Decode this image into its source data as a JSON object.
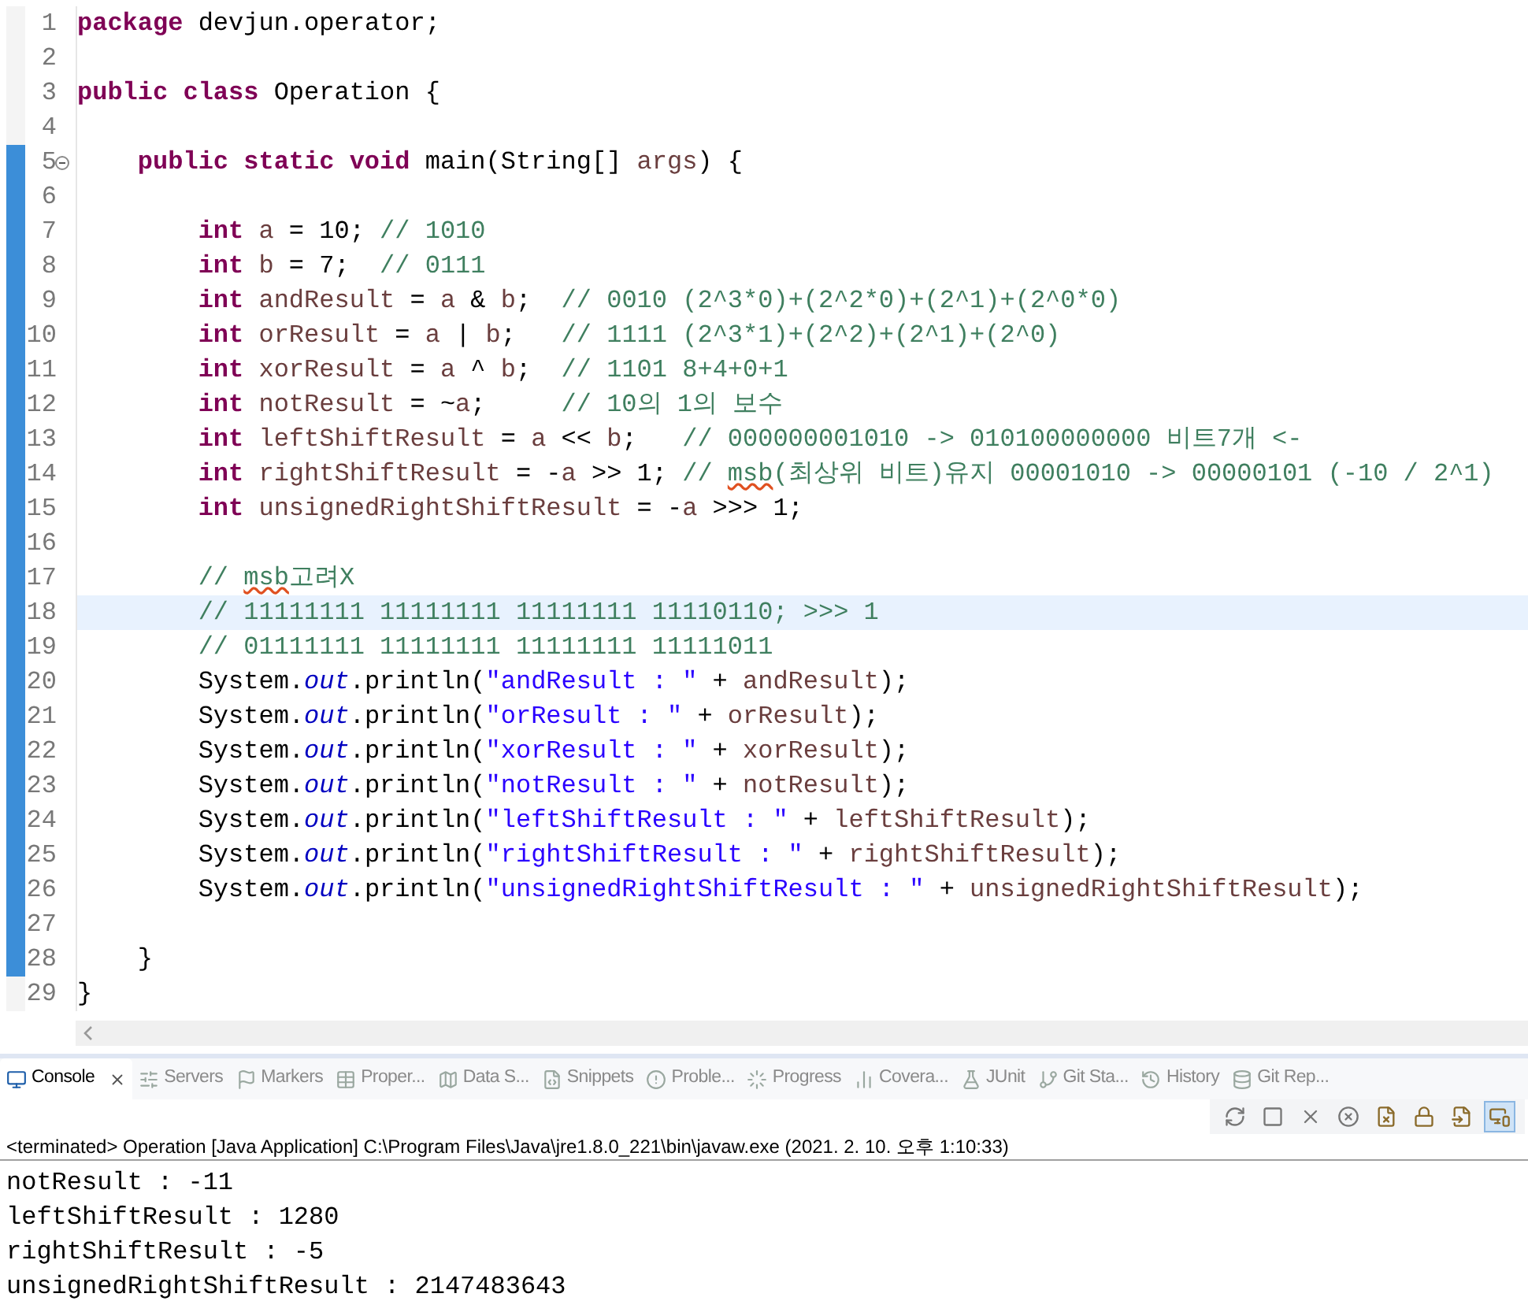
{
  "editor": {
    "lines": [
      {
        "number": "1",
        "changed": false,
        "current": false,
        "fold": false,
        "segments": [
          {
            "kind": "keyword",
            "text": "package"
          },
          {
            "kind": "plain",
            "text": " devjun.operator;"
          }
        ]
      },
      {
        "number": "2",
        "changed": false,
        "current": false,
        "fold": false
      },
      {
        "number": "3",
        "changed": false,
        "current": false,
        "fold": false,
        "segments": [
          {
            "kind": "keyword",
            "text": "public class"
          },
          {
            "kind": "plain",
            "text": " Operation {"
          }
        ]
      },
      {
        "number": "4",
        "changed": false,
        "current": false,
        "fold": false
      },
      {
        "number": "5",
        "changed": true,
        "current": false,
        "fold": true,
        "segments": [
          {
            "kind": "keyword",
            "text": "    public static void"
          },
          {
            "kind": "plain",
            "text": " main(String[] "
          },
          {
            "kind": "variable",
            "text": "args"
          },
          {
            "kind": "plain",
            "text": ") {"
          }
        ]
      },
      {
        "number": "6",
        "changed": true,
        "current": false,
        "fold": false
      },
      {
        "number": "7",
        "changed": true,
        "current": false,
        "fold": false,
        "segments": [
          {
            "kind": "keyword",
            "text": "        int"
          },
          {
            "kind": "variable",
            "text": " a"
          },
          {
            "kind": "plain",
            "text": " = 10; "
          },
          {
            "kind": "comment",
            "text": "// 1010"
          }
        ]
      },
      {
        "number": "8",
        "changed": true,
        "current": false,
        "fold": false,
        "segments": [
          {
            "kind": "keyword",
            "text": "        int"
          },
          {
            "kind": "variable",
            "text": " b"
          },
          {
            "kind": "plain",
            "text": " = 7;  "
          },
          {
            "kind": "comment",
            "text": "// 0111"
          }
        ]
      },
      {
        "number": "9",
        "changed": true,
        "current": false,
        "fold": false,
        "segments": [
          {
            "kind": "keyword",
            "text": "        int"
          },
          {
            "kind": "variable",
            "text": " andResult"
          },
          {
            "kind": "plain",
            "text": " = "
          },
          {
            "kind": "variable",
            "text": "a"
          },
          {
            "kind": "plain",
            "text": " & "
          },
          {
            "kind": "variable",
            "text": "b"
          },
          {
            "kind": "plain",
            "text": ";  "
          },
          {
            "kind": "comment",
            "text": "// 0010 (2^3*0)+(2^2*0)+(2^1)+(2^0*0)"
          }
        ]
      },
      {
        "number": "10",
        "changed": true,
        "current": false,
        "fold": false,
        "segments": [
          {
            "kind": "keyword",
            "text": "        int"
          },
          {
            "kind": "variable",
            "text": " orResult"
          },
          {
            "kind": "plain",
            "text": " = "
          },
          {
            "kind": "variable",
            "text": "a"
          },
          {
            "kind": "plain",
            "text": " | "
          },
          {
            "kind": "variable",
            "text": "b"
          },
          {
            "kind": "plain",
            "text": ";   "
          },
          {
            "kind": "comment",
            "text": "// 1111 (2^3*1)+(2^2)+(2^1)+(2^0)"
          }
        ]
      },
      {
        "number": "11",
        "changed": true,
        "current": false,
        "fold": false,
        "segments": [
          {
            "kind": "keyword",
            "text": "        int"
          },
          {
            "kind": "variable",
            "text": " xorResult"
          },
          {
            "kind": "plain",
            "text": " = "
          },
          {
            "kind": "variable",
            "text": "a"
          },
          {
            "kind": "plain",
            "text": " ^ "
          },
          {
            "kind": "variable",
            "text": "b"
          },
          {
            "kind": "plain",
            "text": ";  "
          },
          {
            "kind": "comment",
            "text": "// 1101 8+4+0+1"
          }
        ]
      },
      {
        "number": "12",
        "changed": true,
        "current": false,
        "fold": false,
        "segments": [
          {
            "kind": "keyword",
            "text": "        int"
          },
          {
            "kind": "variable",
            "text": " notResult"
          },
          {
            "kind": "plain",
            "text": " = ~"
          },
          {
            "kind": "variable",
            "text": "a"
          },
          {
            "kind": "plain",
            "text": ";     "
          },
          {
            "kind": "comment",
            "text": "// 10의 1의 보수"
          }
        ]
      },
      {
        "number": "13",
        "changed": true,
        "current": false,
        "fold": false,
        "segments": [
          {
            "kind": "keyword",
            "text": "        int"
          },
          {
            "kind": "variable",
            "text": " leftShiftResult"
          },
          {
            "kind": "plain",
            "text": " = "
          },
          {
            "kind": "variable",
            "text": "a"
          },
          {
            "kind": "plain",
            "text": " << "
          },
          {
            "kind": "variable",
            "text": "b"
          },
          {
            "kind": "plain",
            "text": ";   "
          },
          {
            "kind": "comment",
            "text": "// 000000001010 -> 010100000000 비트7개 <-"
          }
        ]
      },
      {
        "number": "14",
        "changed": true,
        "current": false,
        "fold": false,
        "segments": [
          {
            "kind": "keyword",
            "text": "        int"
          },
          {
            "kind": "variable",
            "text": " rightShiftResult"
          },
          {
            "kind": "plain",
            "text": " = -"
          },
          {
            "kind": "variable",
            "text": "a"
          },
          {
            "kind": "plain",
            "text": " >> 1; "
          },
          {
            "kind": "comment",
            "text": "// "
          },
          {
            "kind": "misspelled",
            "text": "msb"
          },
          {
            "kind": "comment",
            "text": "(최상위 비트)유지 00001010 -> 00000101 (-10 / 2^1)"
          }
        ]
      },
      {
        "number": "15",
        "changed": true,
        "current": false,
        "fold": false,
        "segments": [
          {
            "kind": "keyword",
            "text": "        int"
          },
          {
            "kind": "variable",
            "text": " unsignedRightShiftResult"
          },
          {
            "kind": "plain",
            "text": " = -"
          },
          {
            "kind": "variable",
            "text": "a"
          },
          {
            "kind": "plain",
            "text": " >>> 1;"
          }
        ]
      },
      {
        "number": "16",
        "changed": true,
        "current": false,
        "fold": false
      },
      {
        "number": "17",
        "changed": true,
        "current": false,
        "fold": false,
        "segments": [
          {
            "kind": "comment",
            "text": "        // "
          },
          {
            "kind": "misspelled",
            "text": "msb"
          },
          {
            "kind": "comment",
            "text": "고려X"
          }
        ]
      },
      {
        "number": "18",
        "changed": true,
        "current": true,
        "fold": false,
        "segments": [
          {
            "kind": "comment",
            "text": "        // 11111111 11111111 11111111 11110110; >>> 1"
          }
        ]
      },
      {
        "number": "19",
        "changed": true,
        "current": false,
        "fold": false,
        "segments": [
          {
            "kind": "comment",
            "text": "        // 01111111 11111111 11111111 11111011"
          }
        ]
      },
      {
        "number": "20",
        "changed": true,
        "current": false,
        "fold": false,
        "segments": [
          {
            "kind": "plain",
            "text": "        System."
          },
          {
            "kind": "field",
            "text": "out"
          },
          {
            "kind": "plain",
            "text": ".println("
          },
          {
            "kind": "string",
            "text": "\"andResult : \""
          },
          {
            "kind": "plain",
            "text": " + "
          },
          {
            "kind": "variable",
            "text": "andResult"
          },
          {
            "kind": "plain",
            "text": ");"
          }
        ]
      },
      {
        "number": "21",
        "changed": true,
        "current": false,
        "fold": false,
        "segments": [
          {
            "kind": "plain",
            "text": "        System."
          },
          {
            "kind": "field",
            "text": "out"
          },
          {
            "kind": "plain",
            "text": ".println("
          },
          {
            "kind": "string",
            "text": "\"orResult : \""
          },
          {
            "kind": "plain",
            "text": " + "
          },
          {
            "kind": "variable",
            "text": "orResult"
          },
          {
            "kind": "plain",
            "text": ");"
          }
        ]
      },
      {
        "number": "22",
        "changed": true,
        "current": false,
        "fold": false,
        "segments": [
          {
            "kind": "plain",
            "text": "        System."
          },
          {
            "kind": "field",
            "text": "out"
          },
          {
            "kind": "plain",
            "text": ".println("
          },
          {
            "kind": "string",
            "text": "\"xorResult : \""
          },
          {
            "kind": "plain",
            "text": " + "
          },
          {
            "kind": "variable",
            "text": "xorResult"
          },
          {
            "kind": "plain",
            "text": ");"
          }
        ]
      },
      {
        "number": "23",
        "changed": true,
        "current": false,
        "fold": false,
        "segments": [
          {
            "kind": "plain",
            "text": "        System."
          },
          {
            "kind": "field",
            "text": "out"
          },
          {
            "kind": "plain",
            "text": ".println("
          },
          {
            "kind": "string",
            "text": "\"notResult : \""
          },
          {
            "kind": "plain",
            "text": " + "
          },
          {
            "kind": "variable",
            "text": "notResult"
          },
          {
            "kind": "plain",
            "text": ");"
          }
        ]
      },
      {
        "number": "24",
        "changed": true,
        "current": false,
        "fold": false,
        "segments": [
          {
            "kind": "plain",
            "text": "        System."
          },
          {
            "kind": "field",
            "text": "out"
          },
          {
            "kind": "plain",
            "text": ".println("
          },
          {
            "kind": "string",
            "text": "\"leftShiftResult : \""
          },
          {
            "kind": "plain",
            "text": " + "
          },
          {
            "kind": "variable",
            "text": "leftShiftResult"
          },
          {
            "kind": "plain",
            "text": ");"
          }
        ]
      },
      {
        "number": "25",
        "changed": true,
        "current": false,
        "fold": false,
        "segments": [
          {
            "kind": "plain",
            "text": "        System."
          },
          {
            "kind": "field",
            "text": "out"
          },
          {
            "kind": "plain",
            "text": ".println("
          },
          {
            "kind": "string",
            "text": "\"rightShiftResult : \""
          },
          {
            "kind": "plain",
            "text": " + "
          },
          {
            "kind": "variable",
            "text": "rightShiftResult"
          },
          {
            "kind": "plain",
            "text": ");"
          }
        ]
      },
      {
        "number": "26",
        "changed": true,
        "current": false,
        "fold": false,
        "segments": [
          {
            "kind": "plain",
            "text": "        System."
          },
          {
            "kind": "field",
            "text": "out"
          },
          {
            "kind": "plain",
            "text": ".println("
          },
          {
            "kind": "string",
            "text": "\"unsignedRightShiftResult : \""
          },
          {
            "kind": "plain",
            "text": " + "
          },
          {
            "kind": "variable",
            "text": "unsignedRightShiftResult"
          },
          {
            "kind": "plain",
            "text": ");"
          }
        ]
      },
      {
        "number": "27",
        "changed": true,
        "current": false,
        "fold": false
      },
      {
        "number": "28",
        "changed": true,
        "current": false,
        "fold": false,
        "segments": [
          {
            "kind": "plain",
            "text": "    }"
          }
        ]
      },
      {
        "number": "29",
        "changed": false,
        "current": false,
        "fold": false,
        "segments": [
          {
            "kind": "plain",
            "text": "}"
          }
        ]
      }
    ]
  },
  "views": {
    "tabs": [
      {
        "label": "Console",
        "selected": true
      },
      {
        "label": "Servers",
        "selected": false
      },
      {
        "label": "Markers",
        "selected": false
      },
      {
        "label": "Proper...",
        "selected": false
      },
      {
        "label": "Data S...",
        "selected": false
      },
      {
        "label": "Snippets",
        "selected": false
      },
      {
        "label": "Proble...",
        "selected": false
      },
      {
        "label": "Progress",
        "selected": false
      },
      {
        "label": "Covera...",
        "selected": false
      },
      {
        "label": "JUnit",
        "selected": false
      },
      {
        "label": "Git Sta...",
        "selected": false
      },
      {
        "label": "History",
        "selected": false
      },
      {
        "label": "Git Rep...",
        "selected": false
      }
    ],
    "toolbar": [
      {
        "selected": false
      },
      {
        "selected": false
      },
      {
        "selected": false
      },
      {
        "selected": false
      },
      {
        "selected": false
      },
      {
        "selected": false
      },
      {
        "selected": false
      },
      {
        "selected": true
      }
    ]
  },
  "console": {
    "header": "<terminated> Operation [Java Application] C:\\Program Files\\Java\\jre1.8.0_221\\bin\\javaw.exe (2021. 2. 10. 오후 1:10:33)",
    "output": [
      "notResult : -11",
      "leftShiftResult : 1280",
      "rightShiftResult : -5",
      "unsignedRightShiftResult : 2147483643"
    ]
  }
}
